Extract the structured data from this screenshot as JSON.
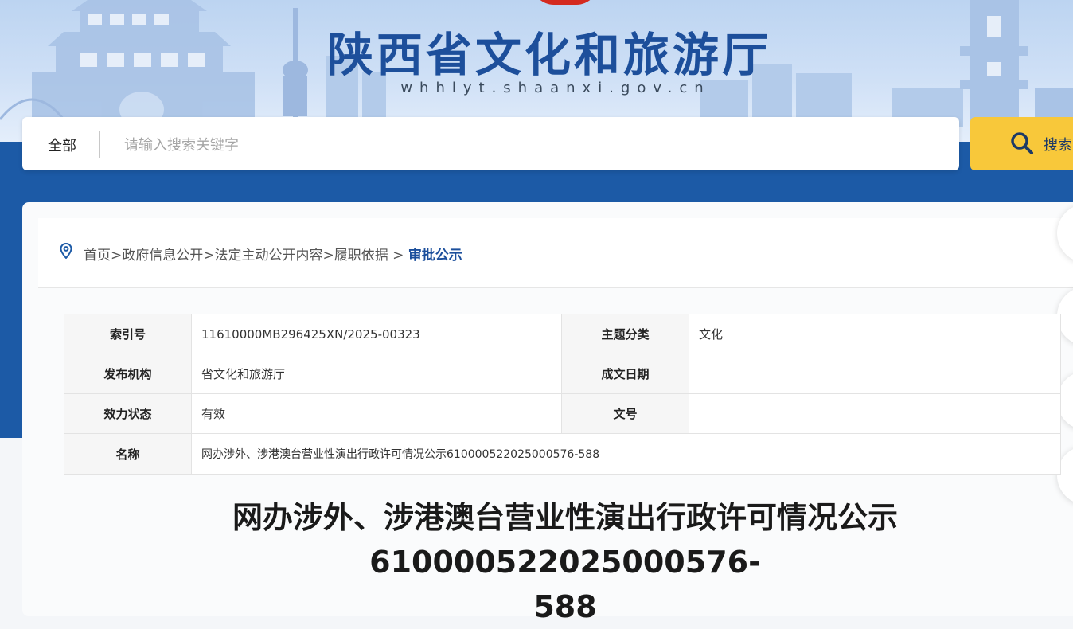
{
  "header": {
    "site_title": "陕西省文化和旅游厅",
    "site_domain": "whhlyt.shaanxi.gov.cn"
  },
  "search": {
    "scope_label": "全部",
    "placeholder": "请输入搜索关键字",
    "value": "",
    "button_label": "搜索",
    "button_icon": "search-icon"
  },
  "breadcrumb": {
    "icon": "location-pin-icon",
    "items": [
      "首页",
      "政府信息公开",
      "法定主动公开内容",
      "履职依据"
    ],
    "separator": ">",
    "current": "审批公示"
  },
  "meta": {
    "index_no_label": "索引号",
    "index_no_value": "11610000MB296425XN/2025-00323",
    "topic_label": "主题分类",
    "topic_value": "文化",
    "publisher_label": "发布机构",
    "publisher_value": "省文化和旅游厅",
    "date_label": "成文日期",
    "date_value": "",
    "status_label": "效力状态",
    "status_value": "有效",
    "docno_label": "文号",
    "docno_value": "",
    "name_label": "名称",
    "name_value": "网办涉外、涉港澳台营业性演出行政许可情况公示610000522025000576-588"
  },
  "document": {
    "title_line1": "网办涉外、涉港澳台营业性演出行政许可情况公示610000522025000576-",
    "title_line2": "588"
  },
  "colors": {
    "brand_blue": "#1c5aa6",
    "title_blue": "#1d4f9b",
    "search_button": "#f8c83a",
    "crumb_current": "#1c4f9c"
  }
}
